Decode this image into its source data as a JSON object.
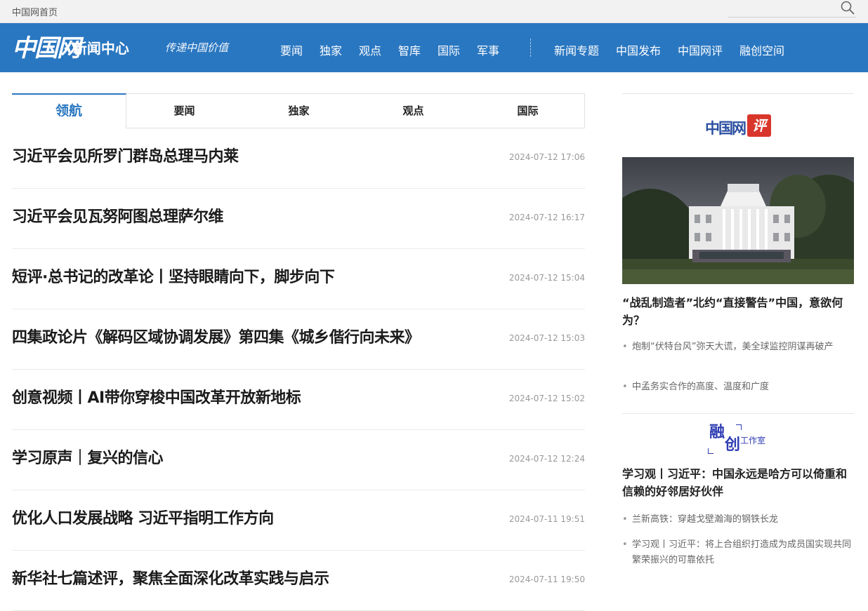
{
  "topbar": {
    "home_link": "中国网首页",
    "search_placeholder": "",
    "search_icon": "search-icon"
  },
  "brand": {
    "logo_mark": "中国网",
    "section": "· 新闻中心",
    "slogan": "传递中国价值"
  },
  "nav": {
    "left_items": [
      "要闻",
      "独家",
      "观点",
      "智库",
      "国际",
      "军事"
    ],
    "right_items": [
      "新闻专题",
      "中国发布",
      "中国网评",
      "融创空间"
    ]
  },
  "tabs": [
    "领航",
    "要闻",
    "独家",
    "观点",
    "国际"
  ],
  "active_tab": 0,
  "news": [
    {
      "title": "习近平会见所罗门群岛总理马内莱",
      "date": "2024-07-12 17:06"
    },
    {
      "title": "习近平会见瓦努阿图总理萨尔维",
      "date": "2024-07-12 16:17"
    },
    {
      "title": "短评·总书记的改革论丨坚持眼睛向下，脚步向下",
      "date": "2024-07-12 15:04"
    },
    {
      "title": "四集政论片《解码区域协调发展》第四集《城乡偕行向未来》",
      "date": "2024-07-12 15:03"
    },
    {
      "title": "创意视频丨AI带你穿梭中国改革开放新地标",
      "date": "2024-07-12 15:02"
    },
    {
      "title": "学习原声｜复兴的信心",
      "date": "2024-07-12 12:24"
    },
    {
      "title": "优化人口发展战略 习近平指明工作方向",
      "date": "2024-07-11 19:51"
    },
    {
      "title": "新华社七篇述评，聚焦全面深化改革实践与启示",
      "date": "2024-07-11 19:50"
    }
  ],
  "sidebar": {
    "logo1_text": "中国网",
    "logo1_badge": "评",
    "headline": "“战乱制造者”北约“直接警告”中国，意欲何为？",
    "links1": [
      "炮制“伏特台风”弥天大谎，美全球监控阴谋再破产",
      "中孟务实合作的高度、温度和广度"
    ],
    "logo2_big1": "融",
    "logo2_big2": "创",
    "logo2_small": "工作室",
    "headline2": "学习观丨习近平：中国永远是哈方可以倚重和信赖的好邻居好伙伴",
    "links2": [
      "兰新高铁：穿越戈壁瀚海的钢铁长龙",
      "学习观丨习近平：将上合组织打造成为成员国实现共同繁荣振兴的可靠依托"
    ]
  },
  "colors": {
    "brand_blue": "#2a77c1",
    "badge_red": "#d9362b"
  }
}
